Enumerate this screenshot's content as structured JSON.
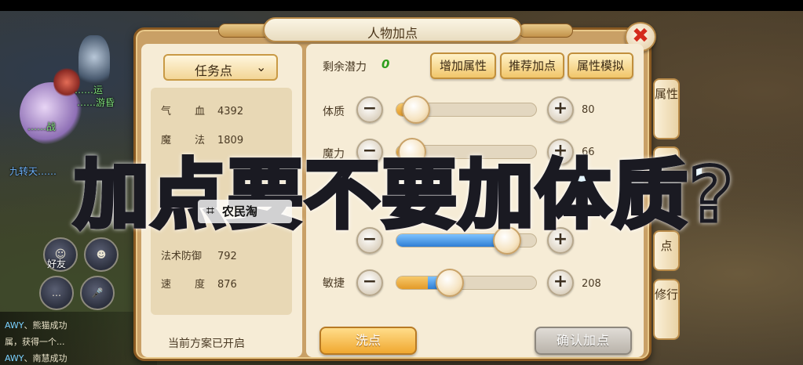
{
  "panel": {
    "title": "人物加点",
    "close_icon": "✖"
  },
  "left": {
    "dropdown_label": "任务点",
    "dropdown_icon": "chevron-down-icon",
    "stats": [
      {
        "key": "气血",
        "value": "4392"
      },
      {
        "key": "魔法",
        "value": "1809"
      },
      {
        "key": "法术防御",
        "value": "792"
      },
      {
        "key": "速度",
        "value": "876"
      }
    ],
    "plan_status": "当前方案已开启"
  },
  "right": {
    "potential_label": "剩余潜力",
    "potential_value": "0",
    "buttons": {
      "add_attr": "增加属性",
      "recommend": "推荐加点",
      "simulate": "属性模拟"
    },
    "attributes": [
      {
        "label": "体质",
        "value": "80",
        "fill": 0.12
      },
      {
        "label": "魔力",
        "value": "66",
        "fill": 0.1
      },
      {
        "label": "",
        "value": "",
        "fill": 0.76
      },
      {
        "label": "敏捷",
        "value": "208",
        "fill": 0.38
      }
    ],
    "wash_button": "洗点",
    "confirm_button": "确认加点"
  },
  "side_tabs": [
    "属性",
    "",
    "点",
    "修行"
  ],
  "caption": "加点要不要加体质?",
  "watermark": "农民淘",
  "world": {
    "chat": [
      {
        "tag": "AWY",
        "text": "、熊猫成功"
      },
      {
        "tag": "",
        "text": "属，获得一个..."
      },
      {
        "tag": "AWY",
        "text": "、南慧成功"
      }
    ],
    "npcs": [
      "……运",
      "……游昏",
      "……战",
      "九转天……"
    ],
    "friend_label": "好友"
  }
}
